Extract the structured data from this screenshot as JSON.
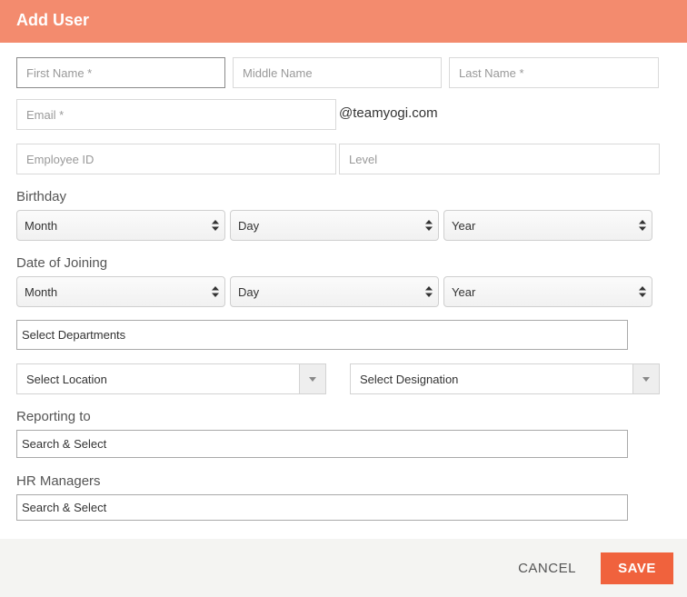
{
  "header": {
    "title": "Add User"
  },
  "form": {
    "first_name_placeholder": "First Name *",
    "middle_name_placeholder": "Middle Name",
    "last_name_placeholder": "Last Name *",
    "email_placeholder": "Email *",
    "email_domain": "@teamyogi.com",
    "employee_id_placeholder": "Employee ID",
    "level_placeholder": "Level",
    "birthday": {
      "label": "Birthday",
      "month": "Month",
      "day": "Day",
      "year": "Year"
    },
    "joining": {
      "label": "Date of Joining",
      "month": "Month",
      "day": "Day",
      "year": "Year"
    },
    "departments_placeholder": "Select Departments",
    "location_placeholder": "Select Location",
    "designation_placeholder": "Select Designation",
    "reporting": {
      "label": "Reporting to",
      "placeholder": "Search & Select"
    },
    "hr": {
      "label": "HR Managers",
      "placeholder": "Search & Select"
    }
  },
  "footer": {
    "cancel_label": "CANCEL",
    "save_label": "SAVE"
  },
  "colors": {
    "header": "#f38b6e",
    "save_button": "#f0623d",
    "footer_bg": "#f4f4f2"
  }
}
